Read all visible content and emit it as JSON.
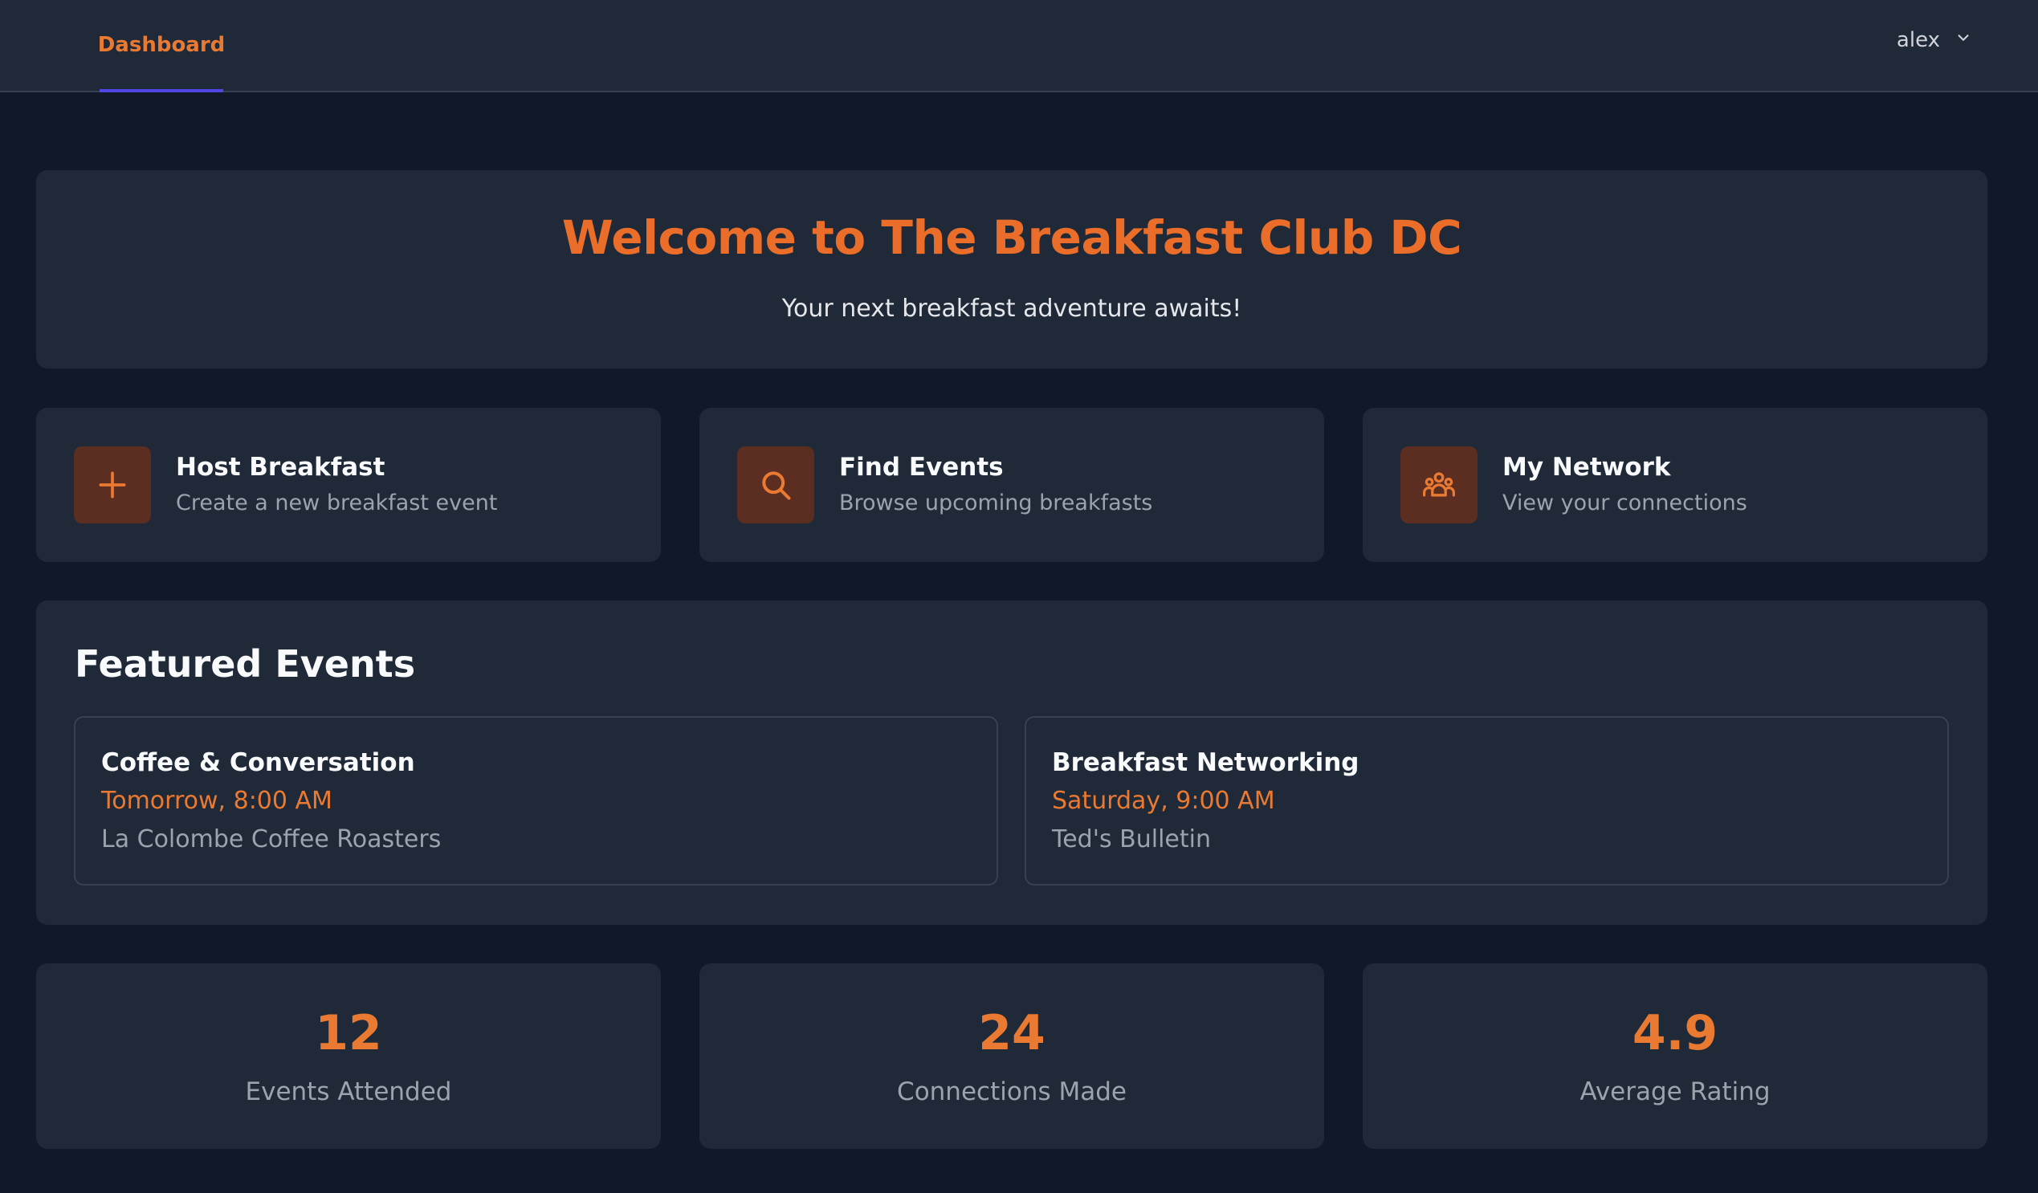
{
  "nav": {
    "tab_label": "Dashboard",
    "user_name": "alex",
    "user_menu_icon": "chevron-down-icon"
  },
  "welcome": {
    "title": "Welcome to The Breakfast Club DC",
    "subtitle": "Your next breakfast adventure awaits!"
  },
  "actions": [
    {
      "title": "Host Breakfast",
      "subtitle": "Create a new breakfast event",
      "icon": "plus-icon"
    },
    {
      "title": "Find Events",
      "subtitle": "Browse upcoming breakfasts",
      "icon": "search-icon"
    },
    {
      "title": "My Network",
      "subtitle": "View your connections",
      "icon": "people-group-icon"
    }
  ],
  "featured": {
    "heading": "Featured Events",
    "events": [
      {
        "title": "Coffee & Conversation",
        "time": "Tomorrow, 8:00 AM",
        "location": "La Colombe Coffee Roasters"
      },
      {
        "title": "Breakfast Networking",
        "time": "Saturday, 9:00 AM",
        "location": "Ted's Bulletin"
      }
    ]
  },
  "stats": [
    {
      "value": "12",
      "label": "Events Attended"
    },
    {
      "value": "24",
      "label": "Connections Made"
    },
    {
      "value": "4.9",
      "label": "Average Rating"
    }
  ],
  "colors": {
    "accent": "#ea7a32",
    "background": "#111827",
    "card": "#1f2937",
    "tab_indicator": "#4f46e5"
  }
}
